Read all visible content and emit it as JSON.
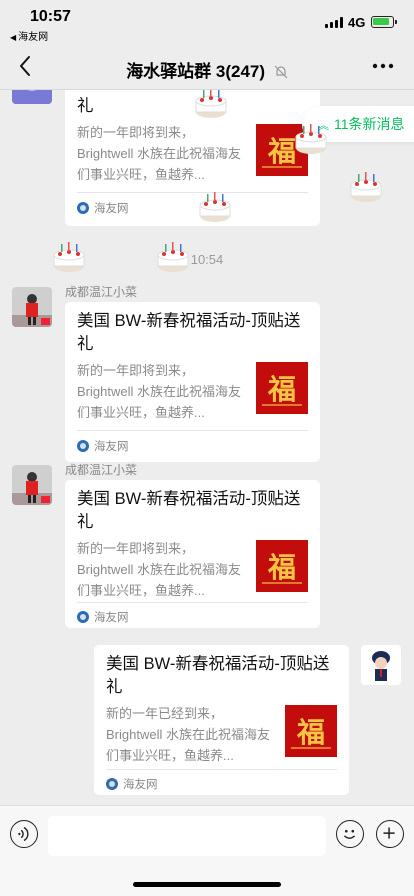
{
  "status": {
    "time": "10:57",
    "back_app": "海友网",
    "network": "4G"
  },
  "nav": {
    "title": "海水驿站群 3(247)"
  },
  "new_messages": {
    "label": "11条新消息"
  },
  "timestamp": "10:54",
  "messages": [
    {
      "sender": "",
      "title": "美国 BW-新春祝福活动-顶贴送礼",
      "desc": "新的一年即将到来，Brightwell 水族在此祝福海友们事业兴旺，鱼越养...",
      "source": "海友网"
    },
    {
      "sender": "成都温江小菜",
      "title": "美国 BW-新春祝福活动-顶贴送礼",
      "desc": "新的一年即将到来，Brightwell 水族在此祝福海友们事业兴旺，鱼越养...",
      "source": "海友网"
    },
    {
      "sender": "成都温江小菜",
      "title": "美国 BW-新春祝福活动-顶贴送礼",
      "desc": "新的一年即将到来，Brightwell 水族在此祝福海友们事业兴旺，鱼越养...",
      "source": "海友网"
    },
    {
      "sender": "",
      "title": "美国 BW-新春祝福活动-顶贴送礼",
      "desc": "新的一年已经到来，Brightwell 水族在此祝福海友们事业兴旺，鱼越养...",
      "source": "海友网"
    }
  ],
  "card_thumb_char": "福",
  "colors": {
    "accent_green": "#07c160",
    "thumb_red": "#c30d0d"
  },
  "icons": [
    "back-arrow-icon",
    "mute-bell-icon",
    "more-dots-icon",
    "voice-icon",
    "emoji-icon",
    "plus-icon",
    "cake-icon"
  ]
}
